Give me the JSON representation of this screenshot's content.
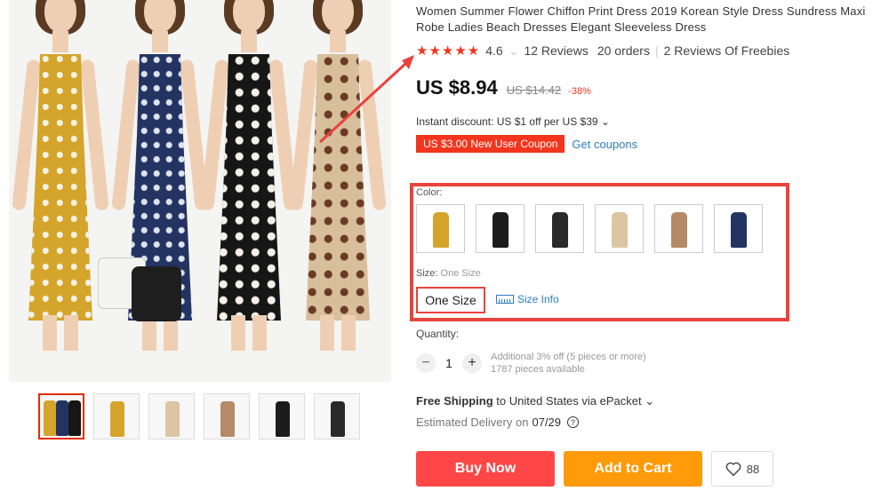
{
  "product": {
    "title": "Women Summer Flower Chiffon Print Dress 2019 Korean Style Dress Sundress Maxi Robe Ladies Beach Dresses Elegant Sleeveless Dress",
    "rating": {
      "stars": "★★★★★",
      "score": "4.6",
      "reviews_link": "12 Reviews",
      "orders": "20 orders",
      "freebies_link": "2 Reviews Of Freebies"
    },
    "price": {
      "current": "US $8.94",
      "original": "US $14.42",
      "discount": "-38%"
    },
    "instant_discount": "Instant discount: US $1 off per US $39 ⌄",
    "coupon": {
      "badge": "US $3.00 New User Coupon",
      "link": "Get coupons"
    },
    "color": {
      "label": "Color:",
      "swatches": [
        {
          "name": "yellow",
          "color": "#d4a52a"
        },
        {
          "name": "black-floral",
          "color": "#1c1c1c"
        },
        {
          "name": "black-print",
          "color": "#2a2a2a"
        },
        {
          "name": "beige",
          "color": "#dcc5a2"
        },
        {
          "name": "brown-floral",
          "color": "#b58a66"
        },
        {
          "name": "navy",
          "color": "#233463"
        }
      ]
    },
    "size": {
      "label": "Size: ",
      "selected_text": "One Size",
      "option": "One Size",
      "info_link": "Size Info"
    },
    "quantity": {
      "label": "Quantity:",
      "minus": "−",
      "value": "1",
      "plus": "+",
      "note_line1": "Additional 3% off (5 pieces or more)",
      "note_line2": "1787 pieces available"
    },
    "shipping": {
      "bold": "Free Shipping",
      "rest": " to United States via ePacket ⌄"
    },
    "delivery": {
      "label": "Estimated Delivery on",
      "date": "07/29",
      "help": "?"
    },
    "actions": {
      "buy_now": "Buy Now",
      "add_to_cart": "Add to Cart",
      "wishlist_count": "88"
    }
  },
  "colors": {
    "accent_red": "#e8433d",
    "star_red": "#f1361d",
    "link_blue": "#2e7dbf",
    "buy_now": "#ff4747",
    "add_to_cart": "#ff9a0a"
  }
}
